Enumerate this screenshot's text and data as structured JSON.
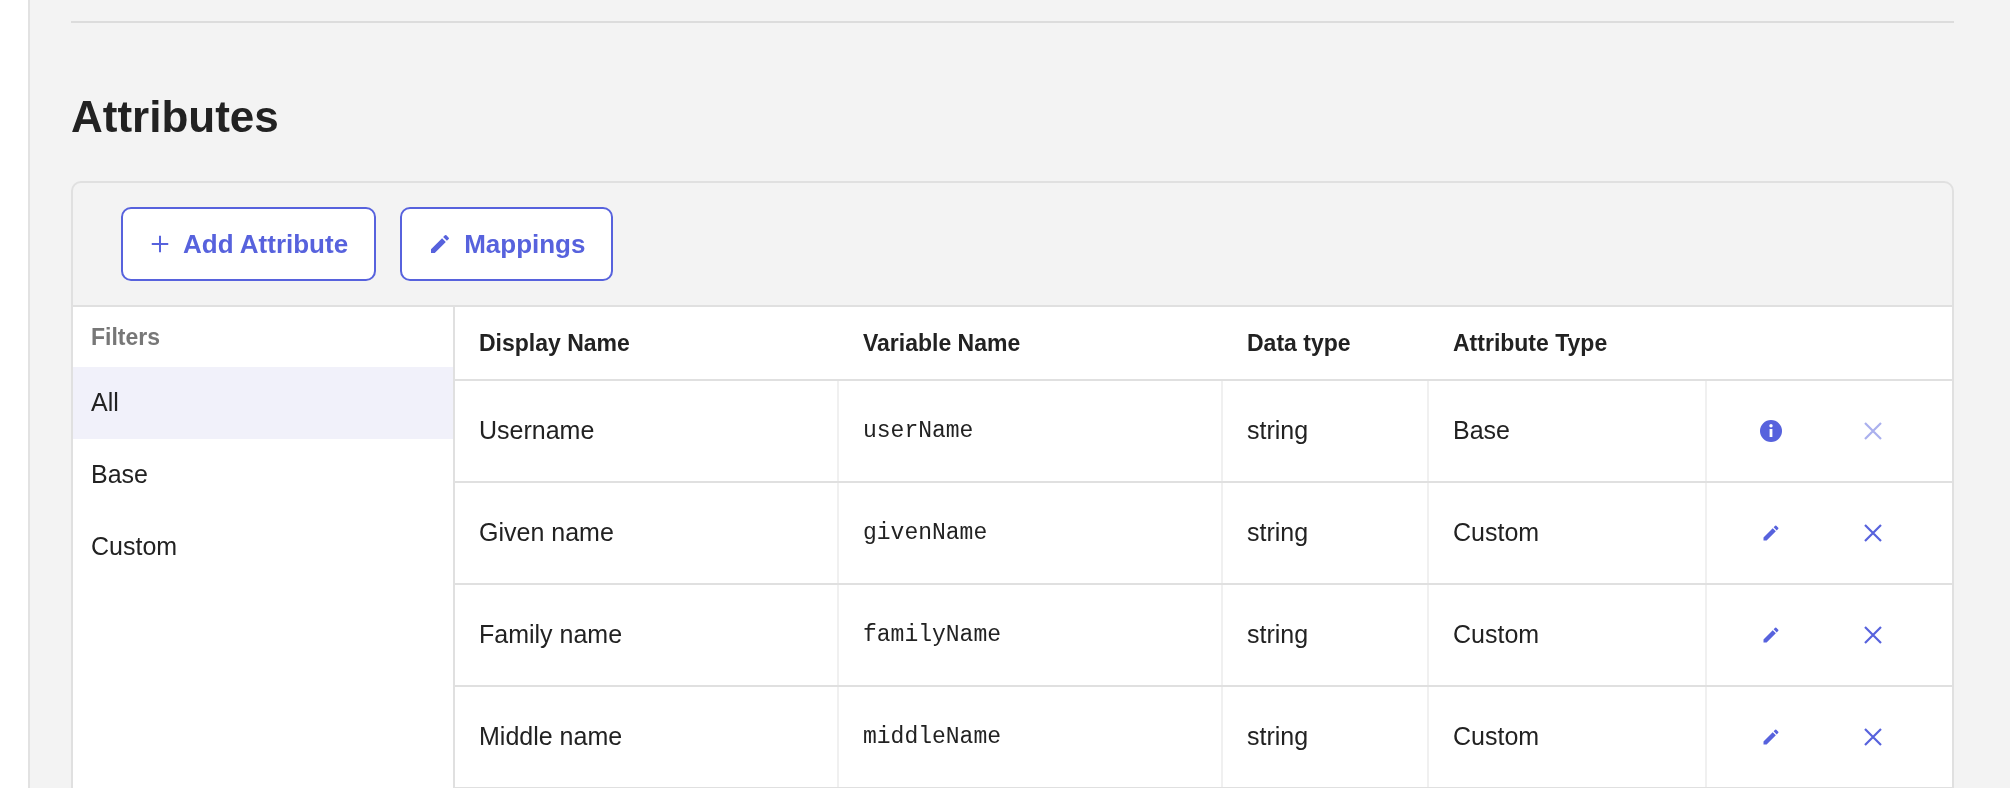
{
  "title": "Attributes",
  "toolbar": [
    {
      "kind": "add",
      "label": "Add Attribute"
    },
    {
      "kind": "edit",
      "label": "Mappings"
    }
  ],
  "filters": {
    "heading": "Filters",
    "items": [
      {
        "label": "All",
        "selected": true
      },
      {
        "label": "Base",
        "selected": false
      },
      {
        "label": "Custom",
        "selected": false
      }
    ]
  },
  "table": {
    "columns": [
      "Display Name",
      "Variable Name",
      "Data type",
      "Attribute Type"
    ],
    "rows": [
      {
        "display_name": "Username",
        "variable_name": "userName",
        "data_type": "string",
        "attribute_type": "Base",
        "locked": true
      },
      {
        "display_name": "Given name",
        "variable_name": "givenName",
        "data_type": "string",
        "attribute_type": "Custom",
        "locked": false
      },
      {
        "display_name": "Family name",
        "variable_name": "familyName",
        "data_type": "string",
        "attribute_type": "Custom",
        "locked": false
      },
      {
        "display_name": "Middle name",
        "variable_name": "middleName",
        "data_type": "string",
        "attribute_type": "Custom",
        "locked": false
      }
    ]
  }
}
